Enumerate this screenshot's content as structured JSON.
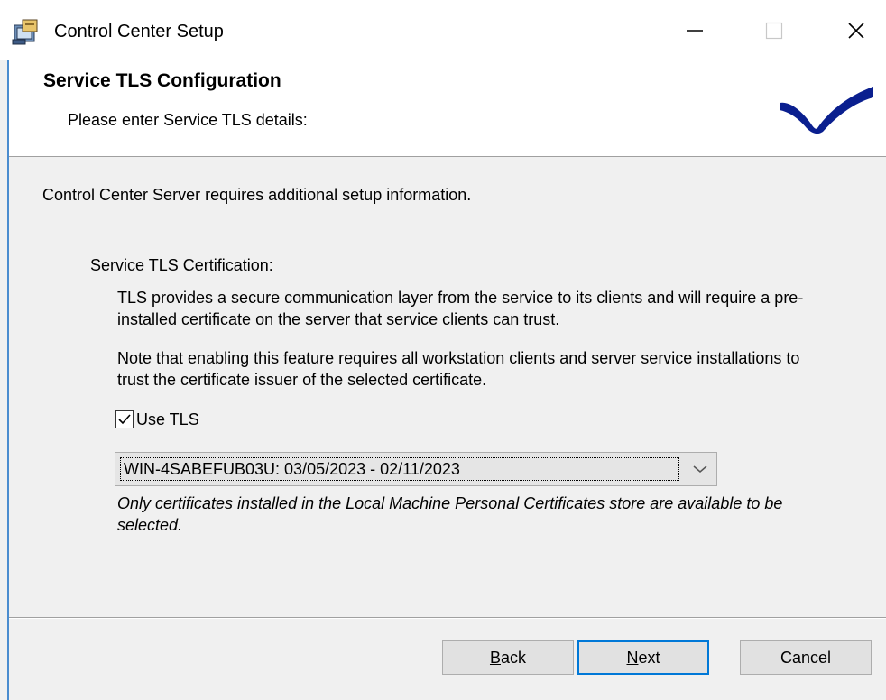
{
  "window": {
    "title": "Control Center Setup",
    "app_icon": "installer-icon",
    "controls": {
      "minimize_icon": "minimize-icon",
      "maximize_icon": "maximize-icon",
      "close_icon": "close-icon"
    }
  },
  "banner": {
    "title": "Service TLS Configuration",
    "subtitle": "Please enter Service TLS details:",
    "logo_icon": "brand-checkmark-logo",
    "logo_color": "#0a1f8f"
  },
  "body": {
    "intro": "Control Center Server requires additional setup information.",
    "section_label": "Service TLS Certification:",
    "paragraph1": "TLS provides a secure communication layer from the service to its clients and will require a pre-installed certificate on the server that service clients can trust.",
    "paragraph2": "Note that enabling this feature requires all workstation clients and server service installations to trust the certificate issuer of the selected certificate.",
    "use_tls": {
      "label": "Use TLS",
      "checked": true
    },
    "certificate_select": {
      "value": "WIN-4SABEFUB03U: 03/05/2023 - 02/11/2023",
      "arrow_icon": "chevron-down-icon"
    },
    "note": "Only certificates installed in the Local Machine Personal Certificates store are available to be selected."
  },
  "footer": {
    "back_label": "Back",
    "next_label": "Next",
    "cancel_label": "Cancel"
  },
  "colors": {
    "focus_border": "#0078d7",
    "accent_edge": "#4a8ccf"
  }
}
